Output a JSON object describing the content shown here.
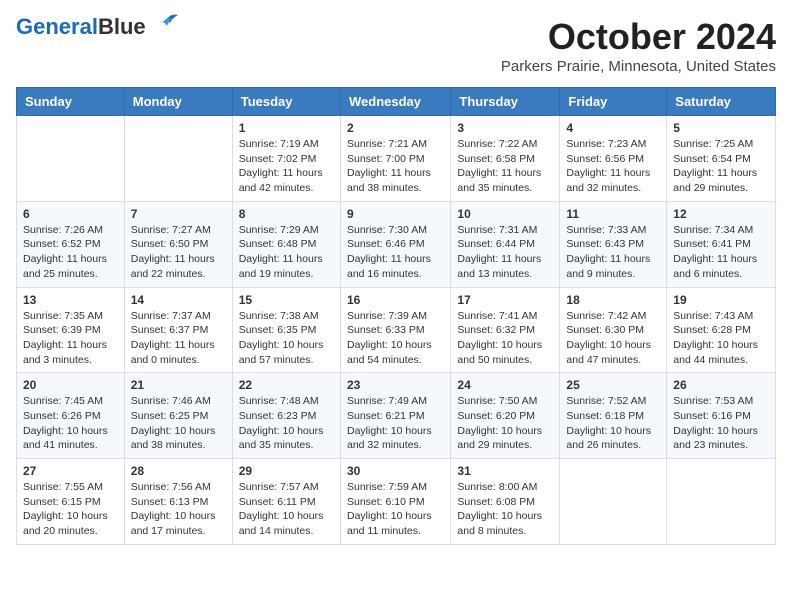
{
  "header": {
    "logo_line1": "General",
    "logo_line2": "Blue",
    "month": "October 2024",
    "location": "Parkers Prairie, Minnesota, United States"
  },
  "weekdays": [
    "Sunday",
    "Monday",
    "Tuesday",
    "Wednesday",
    "Thursday",
    "Friday",
    "Saturday"
  ],
  "weeks": [
    [
      {
        "day": "",
        "sunrise": "",
        "sunset": "",
        "daylight": ""
      },
      {
        "day": "",
        "sunrise": "",
        "sunset": "",
        "daylight": ""
      },
      {
        "day": "1",
        "sunrise": "Sunrise: 7:19 AM",
        "sunset": "Sunset: 7:02 PM",
        "daylight": "Daylight: 11 hours and 42 minutes."
      },
      {
        "day": "2",
        "sunrise": "Sunrise: 7:21 AM",
        "sunset": "Sunset: 7:00 PM",
        "daylight": "Daylight: 11 hours and 38 minutes."
      },
      {
        "day": "3",
        "sunrise": "Sunrise: 7:22 AM",
        "sunset": "Sunset: 6:58 PM",
        "daylight": "Daylight: 11 hours and 35 minutes."
      },
      {
        "day": "4",
        "sunrise": "Sunrise: 7:23 AM",
        "sunset": "Sunset: 6:56 PM",
        "daylight": "Daylight: 11 hours and 32 minutes."
      },
      {
        "day": "5",
        "sunrise": "Sunrise: 7:25 AM",
        "sunset": "Sunset: 6:54 PM",
        "daylight": "Daylight: 11 hours and 29 minutes."
      }
    ],
    [
      {
        "day": "6",
        "sunrise": "Sunrise: 7:26 AM",
        "sunset": "Sunset: 6:52 PM",
        "daylight": "Daylight: 11 hours and 25 minutes."
      },
      {
        "day": "7",
        "sunrise": "Sunrise: 7:27 AM",
        "sunset": "Sunset: 6:50 PM",
        "daylight": "Daylight: 11 hours and 22 minutes."
      },
      {
        "day": "8",
        "sunrise": "Sunrise: 7:29 AM",
        "sunset": "Sunset: 6:48 PM",
        "daylight": "Daylight: 11 hours and 19 minutes."
      },
      {
        "day": "9",
        "sunrise": "Sunrise: 7:30 AM",
        "sunset": "Sunset: 6:46 PM",
        "daylight": "Daylight: 11 hours and 16 minutes."
      },
      {
        "day": "10",
        "sunrise": "Sunrise: 7:31 AM",
        "sunset": "Sunset: 6:44 PM",
        "daylight": "Daylight: 11 hours and 13 minutes."
      },
      {
        "day": "11",
        "sunrise": "Sunrise: 7:33 AM",
        "sunset": "Sunset: 6:43 PM",
        "daylight": "Daylight: 11 hours and 9 minutes."
      },
      {
        "day": "12",
        "sunrise": "Sunrise: 7:34 AM",
        "sunset": "Sunset: 6:41 PM",
        "daylight": "Daylight: 11 hours and 6 minutes."
      }
    ],
    [
      {
        "day": "13",
        "sunrise": "Sunrise: 7:35 AM",
        "sunset": "Sunset: 6:39 PM",
        "daylight": "Daylight: 11 hours and 3 minutes."
      },
      {
        "day": "14",
        "sunrise": "Sunrise: 7:37 AM",
        "sunset": "Sunset: 6:37 PM",
        "daylight": "Daylight: 11 hours and 0 minutes."
      },
      {
        "day": "15",
        "sunrise": "Sunrise: 7:38 AM",
        "sunset": "Sunset: 6:35 PM",
        "daylight": "Daylight: 10 hours and 57 minutes."
      },
      {
        "day": "16",
        "sunrise": "Sunrise: 7:39 AM",
        "sunset": "Sunset: 6:33 PM",
        "daylight": "Daylight: 10 hours and 54 minutes."
      },
      {
        "day": "17",
        "sunrise": "Sunrise: 7:41 AM",
        "sunset": "Sunset: 6:32 PM",
        "daylight": "Daylight: 10 hours and 50 minutes."
      },
      {
        "day": "18",
        "sunrise": "Sunrise: 7:42 AM",
        "sunset": "Sunset: 6:30 PM",
        "daylight": "Daylight: 10 hours and 47 minutes."
      },
      {
        "day": "19",
        "sunrise": "Sunrise: 7:43 AM",
        "sunset": "Sunset: 6:28 PM",
        "daylight": "Daylight: 10 hours and 44 minutes."
      }
    ],
    [
      {
        "day": "20",
        "sunrise": "Sunrise: 7:45 AM",
        "sunset": "Sunset: 6:26 PM",
        "daylight": "Daylight: 10 hours and 41 minutes."
      },
      {
        "day": "21",
        "sunrise": "Sunrise: 7:46 AM",
        "sunset": "Sunset: 6:25 PM",
        "daylight": "Daylight: 10 hours and 38 minutes."
      },
      {
        "day": "22",
        "sunrise": "Sunrise: 7:48 AM",
        "sunset": "Sunset: 6:23 PM",
        "daylight": "Daylight: 10 hours and 35 minutes."
      },
      {
        "day": "23",
        "sunrise": "Sunrise: 7:49 AM",
        "sunset": "Sunset: 6:21 PM",
        "daylight": "Daylight: 10 hours and 32 minutes."
      },
      {
        "day": "24",
        "sunrise": "Sunrise: 7:50 AM",
        "sunset": "Sunset: 6:20 PM",
        "daylight": "Daylight: 10 hours and 29 minutes."
      },
      {
        "day": "25",
        "sunrise": "Sunrise: 7:52 AM",
        "sunset": "Sunset: 6:18 PM",
        "daylight": "Daylight: 10 hours and 26 minutes."
      },
      {
        "day": "26",
        "sunrise": "Sunrise: 7:53 AM",
        "sunset": "Sunset: 6:16 PM",
        "daylight": "Daylight: 10 hours and 23 minutes."
      }
    ],
    [
      {
        "day": "27",
        "sunrise": "Sunrise: 7:55 AM",
        "sunset": "Sunset: 6:15 PM",
        "daylight": "Daylight: 10 hours and 20 minutes."
      },
      {
        "day": "28",
        "sunrise": "Sunrise: 7:56 AM",
        "sunset": "Sunset: 6:13 PM",
        "daylight": "Daylight: 10 hours and 17 minutes."
      },
      {
        "day": "29",
        "sunrise": "Sunrise: 7:57 AM",
        "sunset": "Sunset: 6:11 PM",
        "daylight": "Daylight: 10 hours and 14 minutes."
      },
      {
        "day": "30",
        "sunrise": "Sunrise: 7:59 AM",
        "sunset": "Sunset: 6:10 PM",
        "daylight": "Daylight: 10 hours and 11 minutes."
      },
      {
        "day": "31",
        "sunrise": "Sunrise: 8:00 AM",
        "sunset": "Sunset: 6:08 PM",
        "daylight": "Daylight: 10 hours and 8 minutes."
      },
      {
        "day": "",
        "sunrise": "",
        "sunset": "",
        "daylight": ""
      },
      {
        "day": "",
        "sunrise": "",
        "sunset": "",
        "daylight": ""
      }
    ]
  ]
}
